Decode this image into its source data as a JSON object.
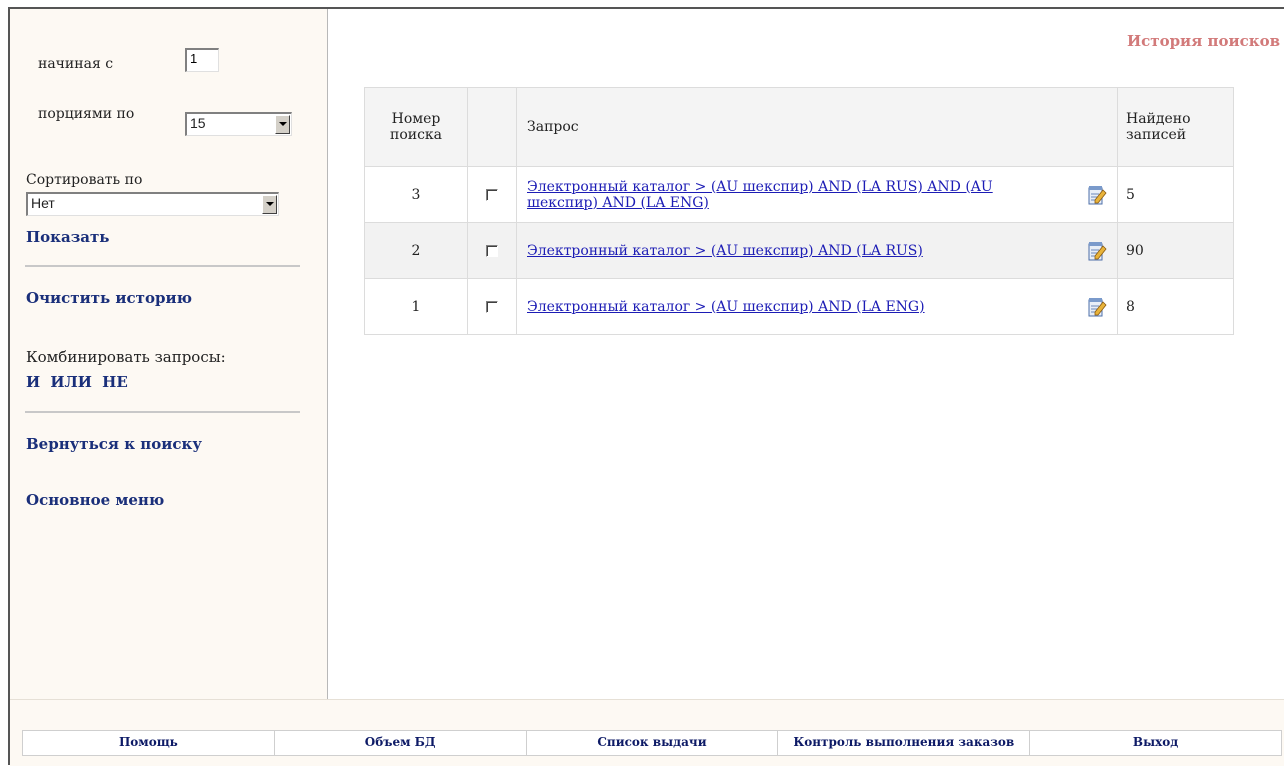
{
  "sidebar": {
    "start_label": "начиная с",
    "start_value": "1",
    "portion_label": "порциями по",
    "portion_value": "15",
    "sort_label": "Сортировать по",
    "sort_value": "Нет",
    "show_label": "Показать",
    "clear_history": "Очистить историю",
    "combine_label": "Комбинировать запросы:",
    "combine_ops": [
      "И",
      "ИЛИ",
      "НЕ"
    ],
    "back_to_search": "Вернуться к поиску",
    "main_menu": "Основное меню"
  },
  "page": {
    "title": "История поисков"
  },
  "table": {
    "headers": {
      "num": "Номер поиска",
      "query": "Запрос",
      "found": "Найдено записей"
    },
    "rows": [
      {
        "num": "3",
        "query": "Электронный каталог > (AU шекспир) AND (LA RUS) AND (AU шекспир) AND (LA ENG)",
        "found": "5"
      },
      {
        "num": "2",
        "query": "Электронный каталог > (AU шекспир) AND (LA RUS)",
        "found": "90"
      },
      {
        "num": "1",
        "query": "Электронный каталог > (AU шекспир) AND (LA ENG)",
        "found": "8"
      }
    ],
    "row_icon": "edit-notepad-icon"
  },
  "footer": {
    "items": [
      "Помощь",
      "Объем БД",
      "Список выдачи",
      "Контроль выполнения заказов",
      "Выход"
    ]
  }
}
